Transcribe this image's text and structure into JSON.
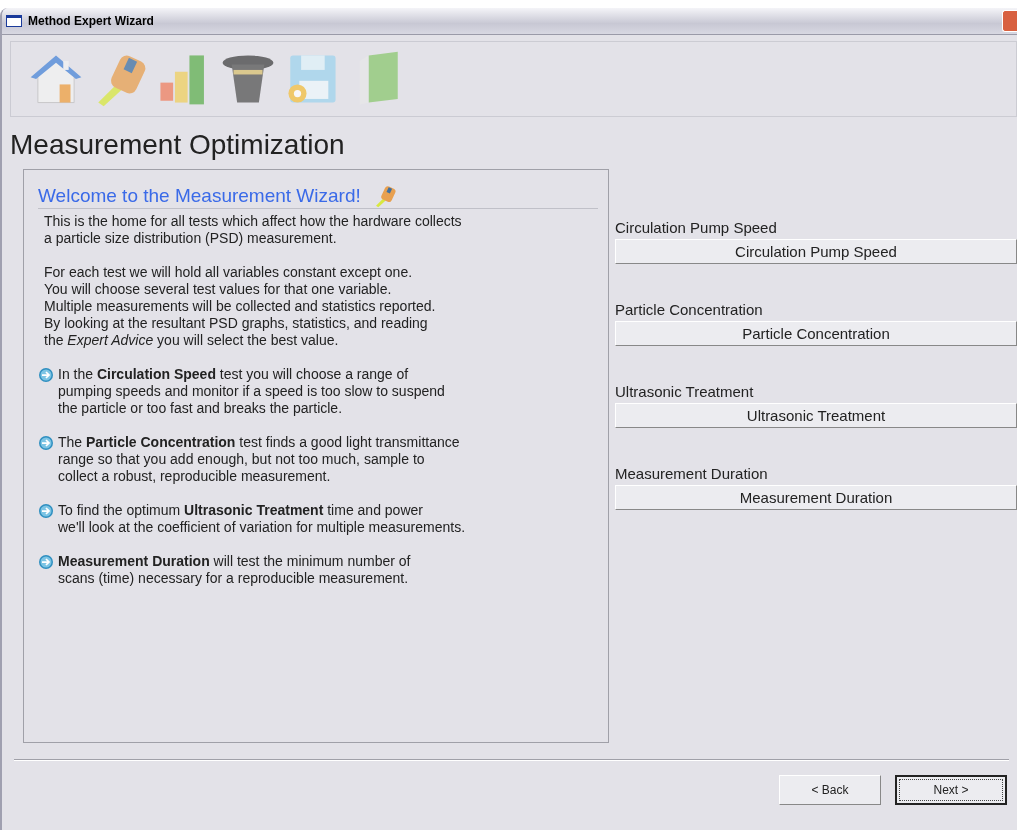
{
  "window": {
    "title": "Method Expert Wizard"
  },
  "toolbar": [
    {
      "kind": "home"
    },
    {
      "kind": "tape"
    },
    {
      "kind": "chart"
    },
    {
      "kind": "hat"
    },
    {
      "kind": "disk"
    },
    {
      "kind": "book"
    }
  ],
  "page_title": "Measurement Optimization",
  "welcome": {
    "heading": "Welcome to the Measurement Wizard!",
    "paragraphs": [
      "This is the home for all tests which affect how the hardware collects\na particle size distribution (PSD) measurement.",
      "For each test we will hold all variables constant except one.\nYou will choose several test values for that one variable.\nMultiple measurements will be collected and statistics reported.\nBy looking at the resultant PSD graphs, statistics, and reading\nthe *Expert Advice* you will select the best value."
    ],
    "bullets": [
      "In the **Circulation Speed** test you will choose a range of\npumping speeds and monitor if a speed is too slow to suspend\nthe particle or too fast and breaks the particle.",
      "The **Particle Concentration** test finds a good light transmittance\nrange so that you add enough, but not too much, sample to\ncollect a robust, reproducible measurement.",
      "To find the optimum **Ultrasonic Treatment** time and power\nwe'll look at the coefficient of variation for multiple measurements.",
      "**Measurement Duration** will test the minimum number of\nscans (time) necessary for a reproducible measurement."
    ]
  },
  "tests": [
    {
      "label": "Circulation Pump Speed",
      "button": "Circulation Pump Speed"
    },
    {
      "label": "Particle Concentration",
      "button": "Particle Concentration"
    },
    {
      "label": "Ultrasonic Treatment",
      "button": "Ultrasonic Treatment"
    },
    {
      "label": "Measurement Duration",
      "button": "Measurement Duration"
    }
  ],
  "buttons": [
    {
      "label": "< Back",
      "focused": false
    },
    {
      "label": "Next >",
      "focused": true
    }
  ]
}
